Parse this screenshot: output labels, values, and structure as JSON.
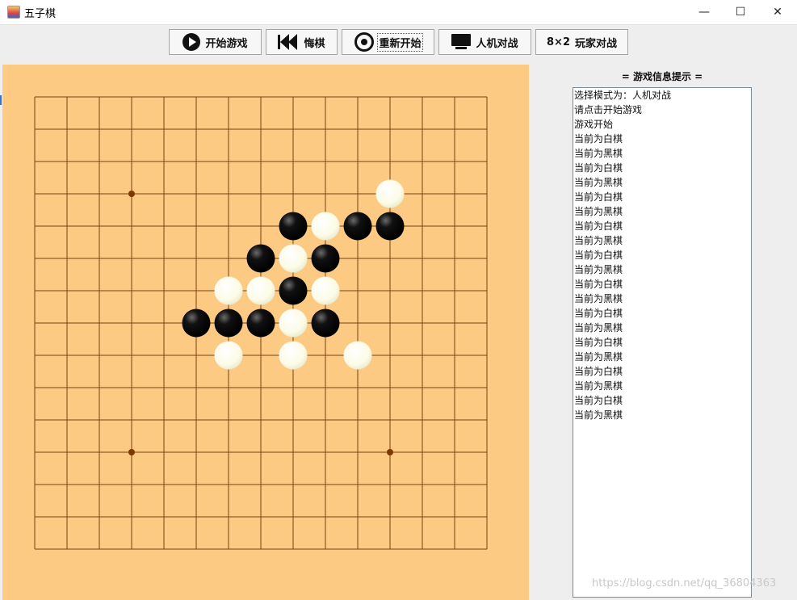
{
  "window": {
    "title": "五子棋",
    "controls": {
      "minimize": "—",
      "maximize": "☐",
      "close": "✕"
    }
  },
  "toolbar": {
    "buttons": [
      {
        "icon": "play-icon",
        "label": "开始游戏"
      },
      {
        "icon": "rewind-icon",
        "label": "悔棋"
      },
      {
        "icon": "restart-icon",
        "label": "重新开始"
      },
      {
        "icon": "monitor-icon",
        "label": "人机对战"
      },
      {
        "icon": "users-icon",
        "icon_text": "8×2",
        "label": "玩家对战"
      }
    ]
  },
  "board": {
    "background": "#fcca82",
    "line_color": "#7a4310",
    "size": 15,
    "star_points": [
      [
        3,
        3
      ],
      [
        3,
        11
      ],
      [
        11,
        11
      ]
    ],
    "stones": [
      {
        "col": 11,
        "row": 3,
        "color": "white"
      },
      {
        "col": 8,
        "row": 4,
        "color": "black"
      },
      {
        "col": 9,
        "row": 4,
        "color": "white"
      },
      {
        "col": 10,
        "row": 4,
        "color": "black"
      },
      {
        "col": 11,
        "row": 4,
        "color": "black"
      },
      {
        "col": 7,
        "row": 5,
        "color": "black"
      },
      {
        "col": 8,
        "row": 5,
        "color": "white"
      },
      {
        "col": 9,
        "row": 5,
        "color": "black"
      },
      {
        "col": 6,
        "row": 6,
        "color": "white"
      },
      {
        "col": 7,
        "row": 6,
        "color": "white"
      },
      {
        "col": 8,
        "row": 6,
        "color": "black"
      },
      {
        "col": 9,
        "row": 6,
        "color": "white"
      },
      {
        "col": 5,
        "row": 7,
        "color": "black"
      },
      {
        "col": 6,
        "row": 7,
        "color": "black"
      },
      {
        "col": 7,
        "row": 7,
        "color": "black"
      },
      {
        "col": 8,
        "row": 7,
        "color": "white"
      },
      {
        "col": 9,
        "row": 7,
        "color": "black"
      },
      {
        "col": 6,
        "row": 8,
        "color": "white"
      },
      {
        "col": 8,
        "row": 8,
        "color": "white"
      },
      {
        "col": 10,
        "row": 8,
        "color": "white"
      }
    ]
  },
  "info_panel": {
    "title": "= 游戏信息提示 =",
    "lines": [
      "选择模式为：人机对战",
      "请点击开始游戏",
      "游戏开始",
      "当前为白棋",
      "当前为黑棋",
      "当前为白棋",
      "当前为黑棋",
      "当前为白棋",
      "当前为黑棋",
      "当前为白棋",
      "当前为黑棋",
      "当前为白棋",
      "当前为黑棋",
      "当前为白棋",
      "当前为黑棋",
      "当前为白棋",
      "当前为黑棋",
      "当前为白棋",
      "当前为黑棋",
      "当前为白棋",
      "当前为黑棋",
      "当前为白棋",
      "当前为黑棋"
    ]
  },
  "watermark": "https://blog.csdn.net/qq_36804363"
}
